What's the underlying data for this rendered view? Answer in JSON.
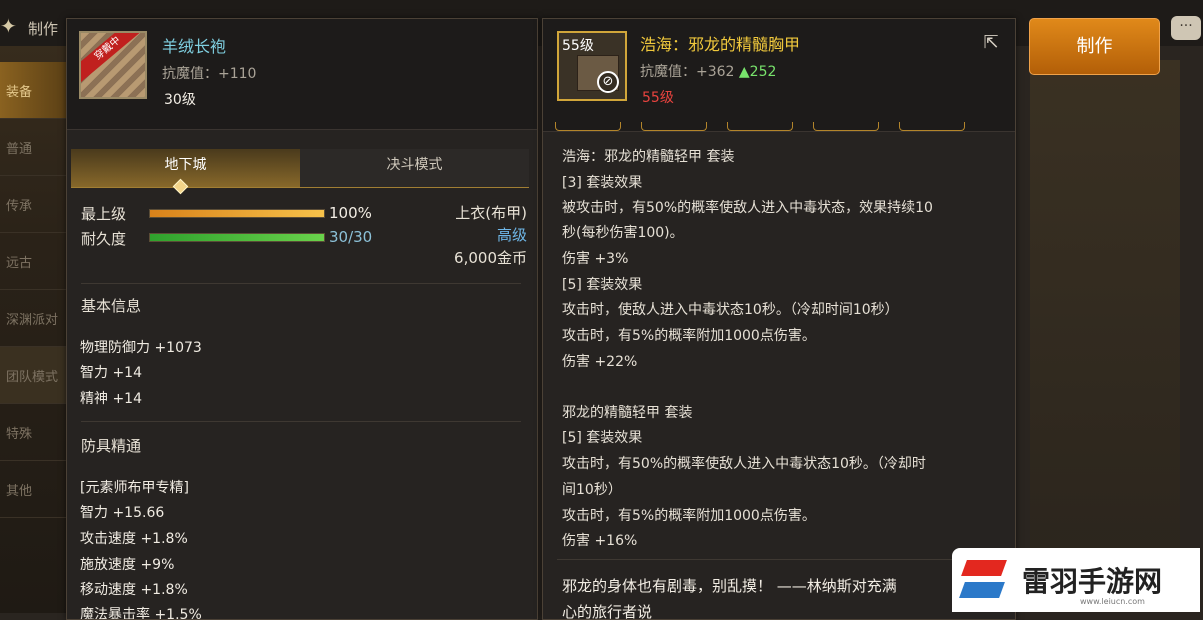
{
  "topbar": {
    "title": "制作"
  },
  "sidebar": {
    "items": [
      "装备",
      "普通",
      "传承",
      "远古",
      "深渊派对",
      "团队模式",
      "特殊",
      "其他"
    ],
    "active": 0
  },
  "left_panel": {
    "item_name": "羊绒长袍",
    "ribbon": "穿戴中",
    "magic_resist": "抗魔值：+110",
    "level": "30级",
    "tabs": [
      "地下城",
      "决斗模式"
    ],
    "active_tab": 0,
    "stats": {
      "grade_label": "最上级",
      "grade_value": "100%",
      "grade_fraction": 1.0,
      "durability_label": "耐久度",
      "durability_value": "30/30",
      "durability_fraction": 1.0
    },
    "info": {
      "slot": "上衣(布甲)",
      "rarity": "高级",
      "price": "6,000金币"
    },
    "basic_title": "基本信息",
    "basic_lines": [
      "物理防御力 +1073",
      "智力 +14",
      "精神 +14"
    ],
    "mastery_title": "防具精通",
    "mastery_lines": [
      "[元素师布甲专精]",
      "智力 +15.66",
      "攻击速度 +1.8%",
      "施放速度 +9%",
      "移动速度 +1.8%",
      "魔法暴击率 +1.5%"
    ]
  },
  "right_panel": {
    "item_name": "浩海：邪龙的精髓胸甲",
    "item_level_badge": "55级",
    "magic_resist": "抗魔值：+362",
    "magic_resist_delta": "▲252",
    "level": "55级",
    "ban_icon": "⊘",
    "lines": [
      "浩海：邪龙的精髓轻甲 套装",
      "[3] 套装效果",
      "被攻击时，有50%的概率使敌人进入中毒状态，效果持续10",
      "秒(每秒伤害100)。",
      "伤害 +3%",
      "[5] 套装效果",
      "攻击时，使敌人进入中毒状态10秒。（冷却时间10秒）",
      "攻击时，有5%的概率附加1000点伤害。",
      "伤害 +22%",
      "",
      "邪龙的精髓轻甲 套装",
      "[5] 套装效果",
      "攻击时，有50%的概率使敌人进入中毒状态10秒。（冷却时",
      "间10秒）",
      "攻击时，有5%的概率附加1000点伤害。",
      "伤害 +16%"
    ],
    "quote": "邪龙的身体也有剧毒，别乱摸！ ——林纳斯对充满",
    "quote2": "心的旅行者说"
  },
  "buttons": {
    "make": "制作"
  },
  "watermark": {
    "text": "雷羽手游网",
    "url": "www.leiucn.com"
  },
  "colors": {
    "accent": "#e0891a",
    "item_name_blue": "#7fcfe0",
    "item_name_gold": "#f0c83c",
    "level_red": "#e8433e",
    "delta_green": "#78e36c"
  }
}
